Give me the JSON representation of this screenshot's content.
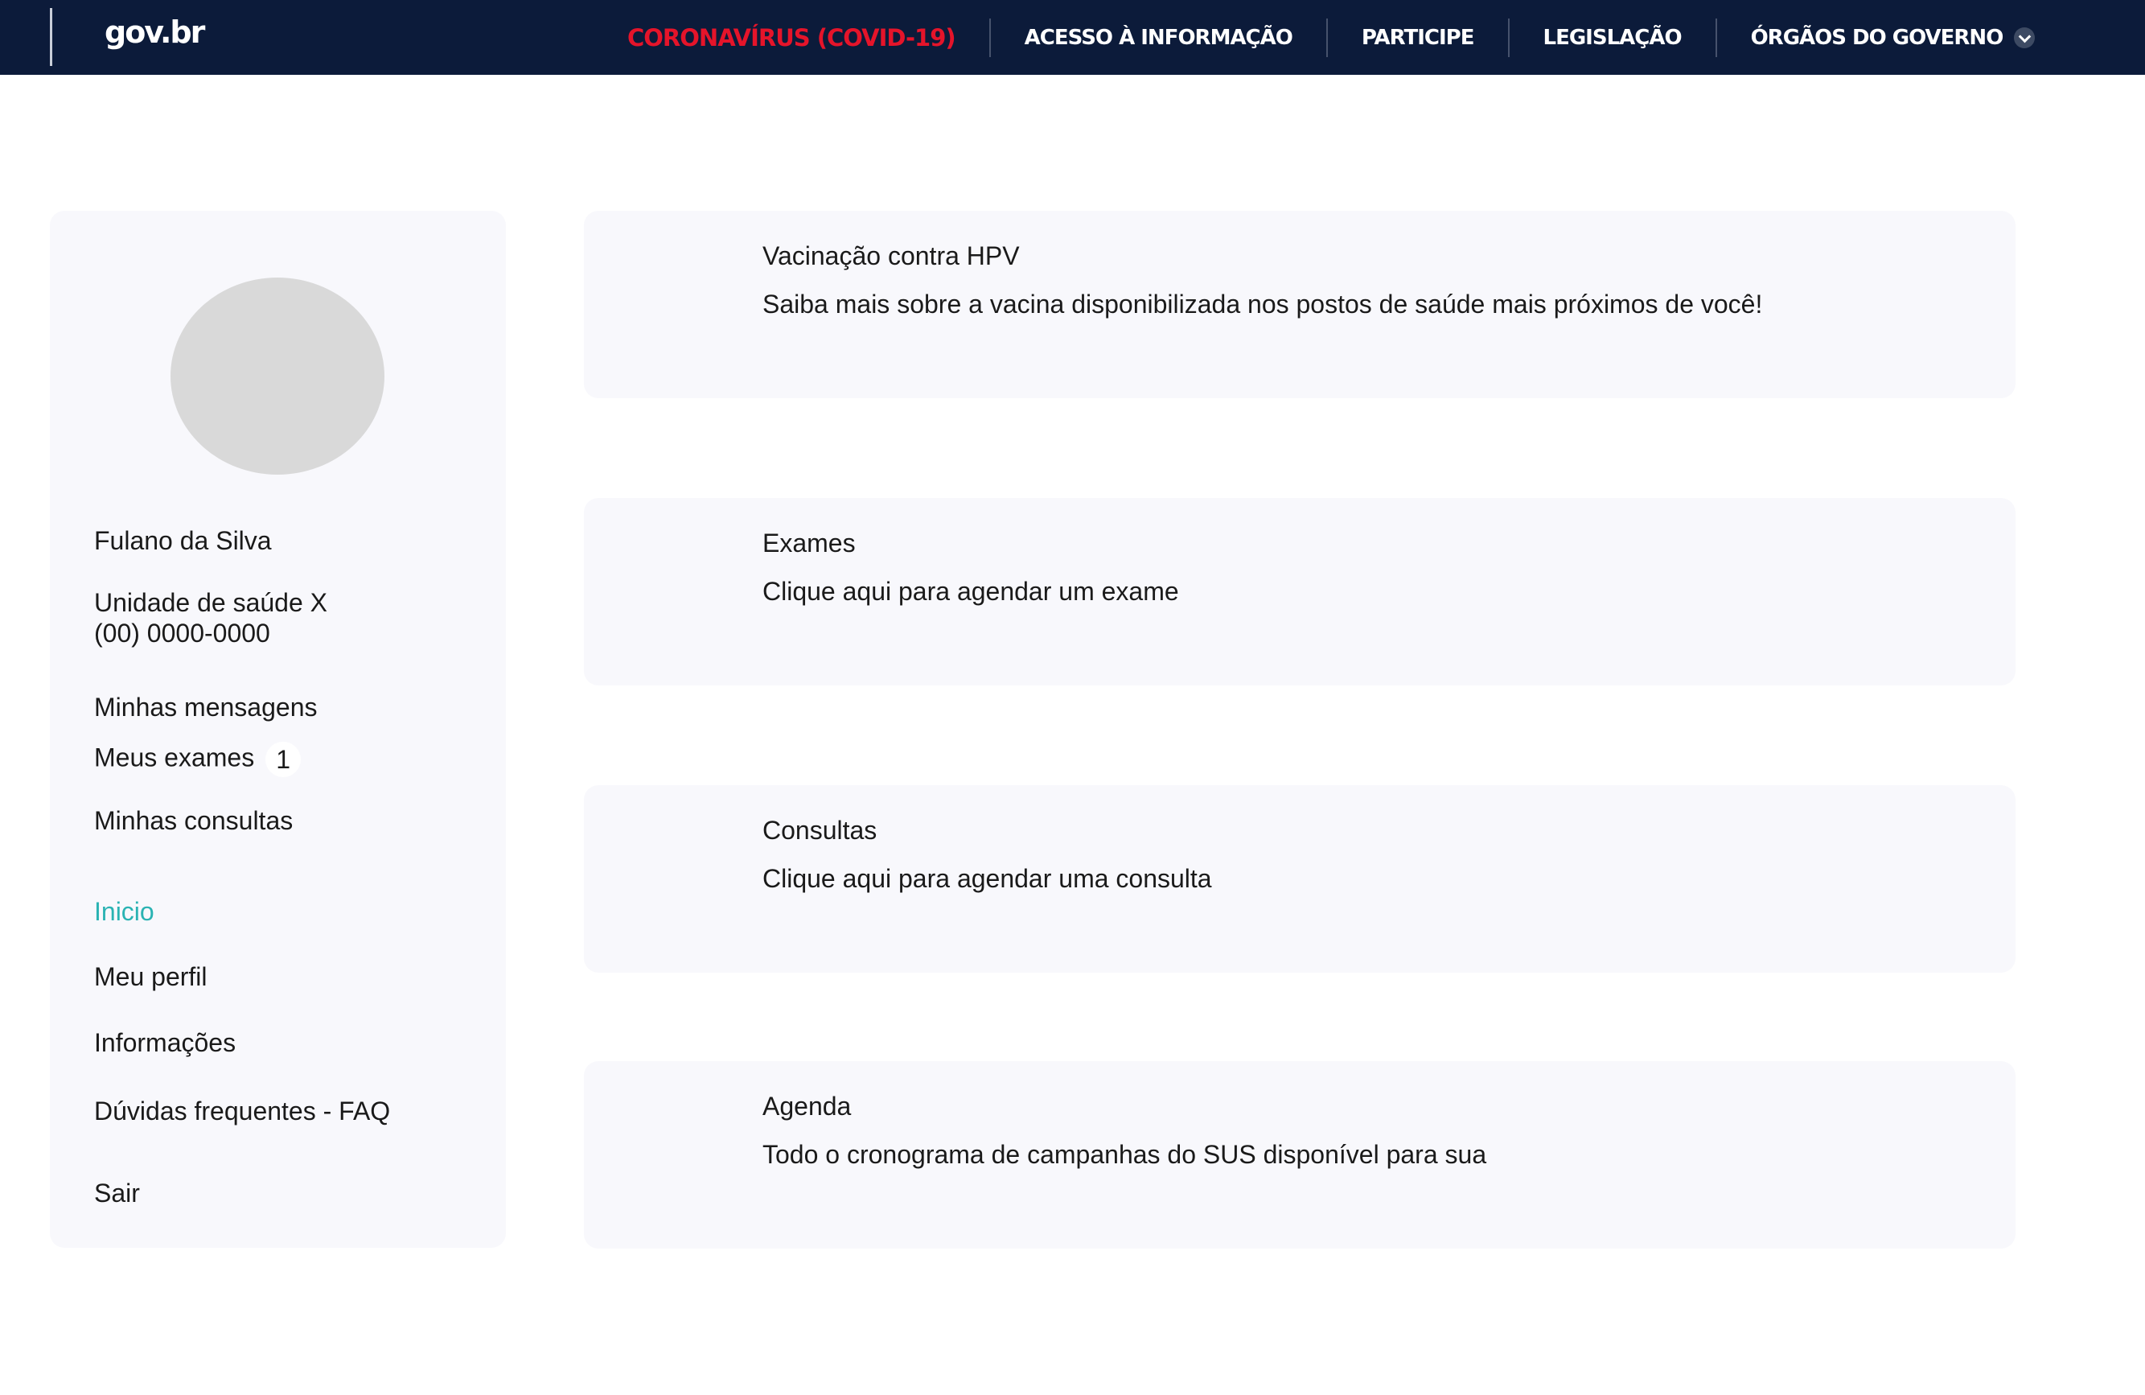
{
  "header": {
    "logo": "gov.br",
    "nav": [
      {
        "label": "CORONAVÍRUS (COVID-19)"
      },
      {
        "label": "ACESSO À INFORMAÇÃO"
      },
      {
        "label": "PARTICIPE"
      },
      {
        "label": "LEGISLAÇÃO"
      },
      {
        "label": "ÓRGÃOS DO GOVERNO"
      }
    ],
    "alert_color": "#e5142a",
    "background_color": "#0c1b3a"
  },
  "sidebar": {
    "user_name": "Fulano da Silva",
    "health_unit": "Unidade de saúde X",
    "phone": "(00) 0000-0000",
    "links": {
      "messages": "Minhas mensagens",
      "exams": "Meus exames",
      "exams_badge": "1",
      "appointments": "Minhas consultas"
    },
    "menu": {
      "home": "Inicio",
      "profile": "Meu perfil",
      "info": "Informações",
      "faq": "Dúvidas frequentes - FAQ",
      "logout": "Sair"
    },
    "active_color": "#2ab3b3"
  },
  "cards": [
    {
      "title": "Vacinação contra HPV",
      "description": "Saiba mais sobre a vacina disponibilizada nos postos de saúde mais próximos de você!"
    },
    {
      "title": "Exames",
      "description": "Clique aqui para agendar um exame"
    },
    {
      "title": "Consultas",
      "description": "Clique aqui para agendar uma consulta"
    },
    {
      "title": "Agenda",
      "description": "Todo o cronograma de campanhas do SUS disponível para sua"
    }
  ]
}
